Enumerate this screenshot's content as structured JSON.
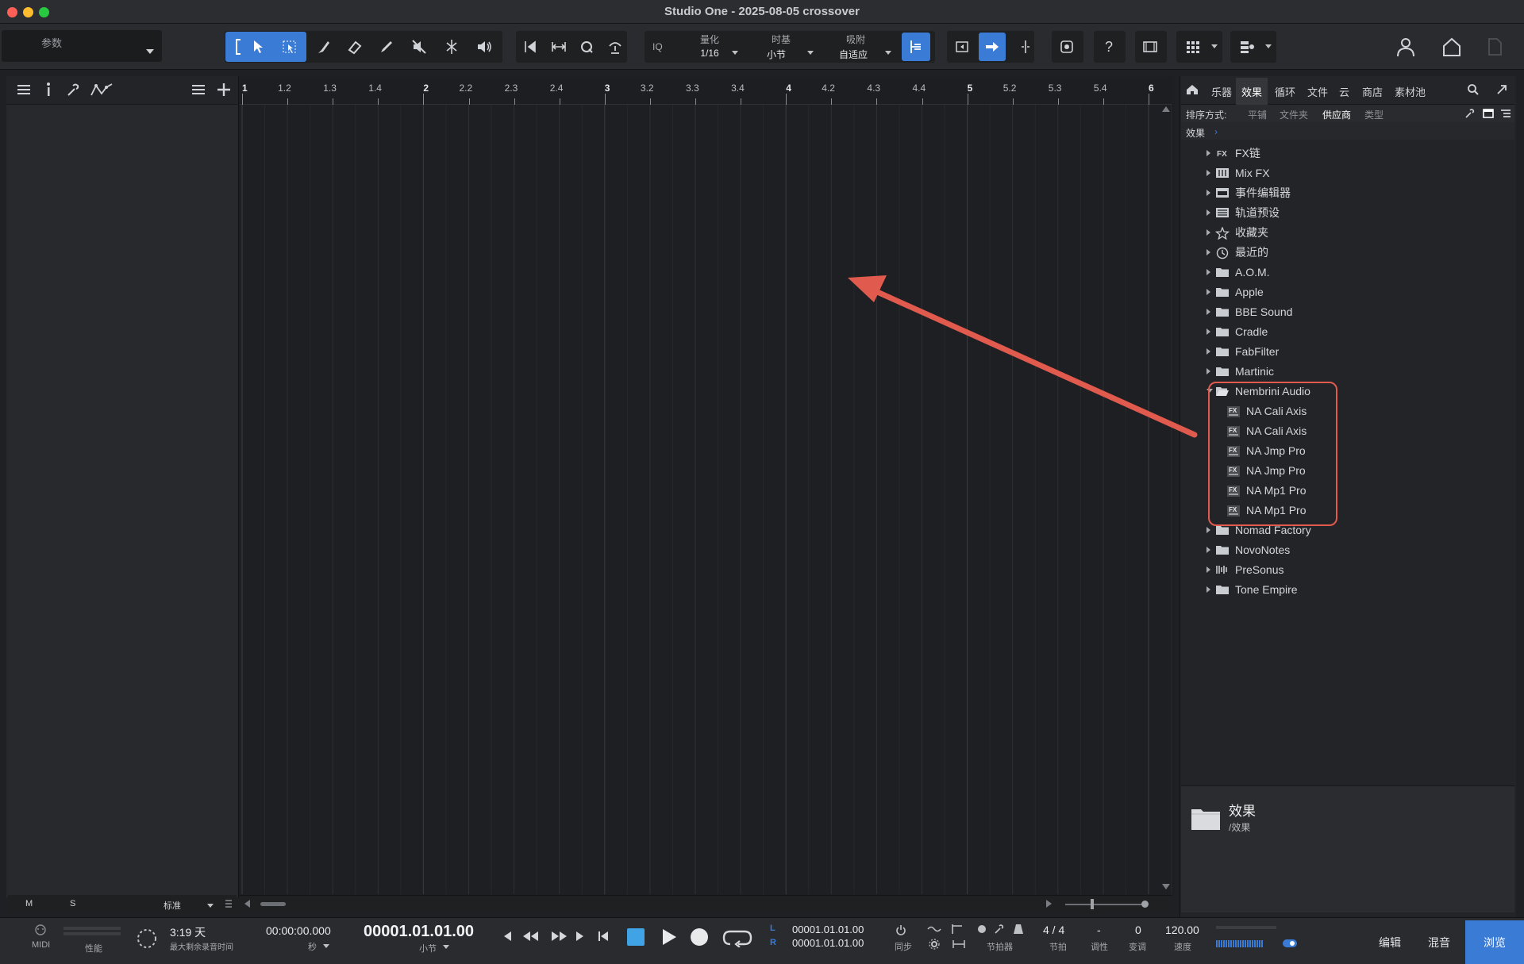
{
  "window": {
    "title": "Studio One - 2025-08-05 crossover"
  },
  "toolbar": {
    "param_label": "参数",
    "iq_label": "IQ",
    "quantize": {
      "label": "量化",
      "value": "1/16"
    },
    "timebase": {
      "label": "时基",
      "value": "小节"
    },
    "snap": {
      "label": "吸附",
      "value": "自适应"
    },
    "help_label": "?"
  },
  "ruler": {
    "marks": [
      {
        "label": "1",
        "major": true
      },
      {
        "label": "1.2",
        "major": false
      },
      {
        "label": "1.3",
        "major": false
      },
      {
        "label": "1.4",
        "major": false
      },
      {
        "label": "2",
        "major": true
      },
      {
        "label": "2.2",
        "major": false
      },
      {
        "label": "2.3",
        "major": false
      },
      {
        "label": "2.4",
        "major": false
      },
      {
        "label": "3",
        "major": true
      },
      {
        "label": "3.2",
        "major": false
      },
      {
        "label": "3.3",
        "major": false
      },
      {
        "label": "3.4",
        "major": false
      },
      {
        "label": "4",
        "major": true
      },
      {
        "label": "4.2",
        "major": false
      },
      {
        "label": "4.3",
        "major": false
      },
      {
        "label": "4.4",
        "major": false
      },
      {
        "label": "5",
        "major": true
      },
      {
        "label": "5.2",
        "major": false
      },
      {
        "label": "5.3",
        "major": false
      },
      {
        "label": "5.4",
        "major": false
      },
      {
        "label": "6",
        "major": true
      }
    ]
  },
  "inspector_footer": {
    "m": "M",
    "s": "S",
    "mode": "标准"
  },
  "browser": {
    "tabs": [
      "乐器",
      "效果",
      "循环",
      "文件",
      "云",
      "商店",
      "素材池"
    ],
    "active_tab": "效果",
    "sort": {
      "label": "排序方式:",
      "options": [
        "平铺",
        "文件夹",
        "供应商",
        "类型"
      ],
      "active": "供应商"
    },
    "breadcrumb": "效果",
    "tree": [
      {
        "label": "FX链",
        "icon": "fx-chain-icon",
        "child": false
      },
      {
        "label": "Mix FX",
        "icon": "mix-fx-icon",
        "child": false
      },
      {
        "label": "事件编辑器",
        "icon": "event-editor-icon",
        "child": false
      },
      {
        "label": "轨道预设",
        "icon": "track-preset-icon",
        "child": false
      },
      {
        "label": "收藏夹",
        "icon": "star-icon",
        "child": false
      },
      {
        "label": "最近的",
        "icon": "clock-icon",
        "child": false
      },
      {
        "label": "A.O.M.",
        "icon": "folder-icon",
        "child": false
      },
      {
        "label": "Apple",
        "icon": "folder-icon",
        "child": false
      },
      {
        "label": "BBE Sound",
        "icon": "folder-icon",
        "child": false
      },
      {
        "label": "Cradle",
        "icon": "folder-icon",
        "child": false
      },
      {
        "label": "FabFilter",
        "icon": "folder-icon",
        "child": false
      },
      {
        "label": "Martinic",
        "icon": "folder-icon",
        "child": false
      },
      {
        "label": "Nembrini Audio",
        "icon": "folder-open-icon",
        "child": false,
        "expanded": true
      },
      {
        "label": "NA Cali Axis",
        "icon": "fx-plugin-icon",
        "child": true
      },
      {
        "label": "NA Cali Axis",
        "icon": "fx-plugin-icon",
        "child": true
      },
      {
        "label": "NA Jmp Pro",
        "icon": "fx-plugin-icon",
        "child": true
      },
      {
        "label": "NA Jmp Pro",
        "icon": "fx-plugin-icon",
        "child": true
      },
      {
        "label": "NA Mp1 Pro",
        "icon": "fx-plugin-icon",
        "child": true
      },
      {
        "label": "NA Mp1 Pro",
        "icon": "fx-plugin-icon",
        "child": true
      },
      {
        "label": "Nomad Factory",
        "icon": "folder-icon",
        "child": false
      },
      {
        "label": "NovoNotes",
        "icon": "folder-icon",
        "child": false
      },
      {
        "label": "PreSonus",
        "icon": "presonus-icon",
        "child": false
      },
      {
        "label": "Tone Empire",
        "icon": "folder-icon",
        "child": false
      }
    ],
    "info": {
      "title": "效果",
      "path": "/效果"
    }
  },
  "transport": {
    "midi_label": "MIDI",
    "perf_label": "性能",
    "rec_time": "3:19 天",
    "rec_time_label": "最大剩余录音时间",
    "time_seconds": "00:00:00.000",
    "time_seconds_unit": "秒",
    "bars_position": "00001.01.01.00",
    "bars_unit": "小节",
    "loop_l_label": "L",
    "loop_r_label": "R",
    "loop_l": "00001.01.01.00",
    "loop_r": "00001.01.01.00",
    "sync_label": "同步",
    "metronome_label": "节拍器",
    "time_sig": "4 / 4",
    "time_sig_label": "节拍",
    "key": "-",
    "key_label": "调性",
    "transpose": "0",
    "transpose_label": "变调",
    "tempo": "120.00",
    "tempo_label": "速度",
    "views": [
      "编辑",
      "混音",
      "浏览"
    ],
    "active_view": "浏览"
  },
  "colors": {
    "accent": "#3a7bd5",
    "annotation": "#e05a4e",
    "background": "#1f2023"
  }
}
